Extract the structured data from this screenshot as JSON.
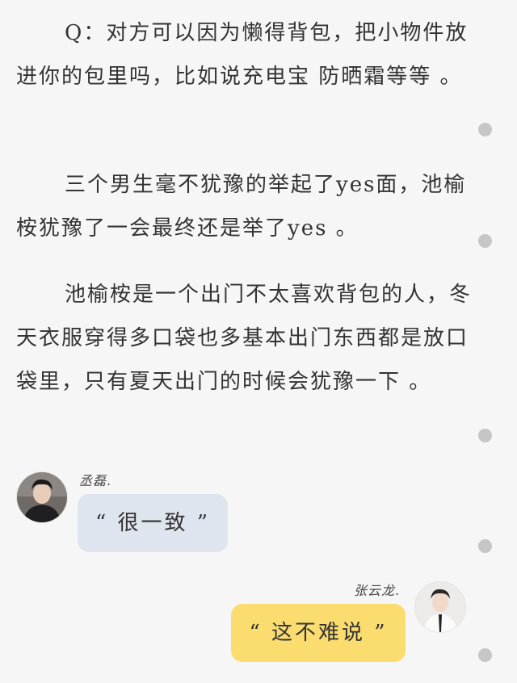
{
  "paragraphs": [
    "Q：对方可以因为懒得背包，把小物件放进你的包里吗，比如说充电宝 防晒霜等等 。",
    "三个男生毫不犹豫的举起了yes面，池榆桉犹豫了一会最终还是举了yes 。",
    "池榆桉是一个出门不太喜欢背包的人，冬天衣服穿得多口袋也多基本出门东西都是放口袋里，只有夏天出门的时候会犹豫一下 。"
  ],
  "chat": {
    "left": {
      "name": "丞磊.",
      "message": "“ 很一致 ”",
      "bubble_color": "#dfe5ee"
    },
    "right": {
      "name": "张云龙.",
      "message": "“ 这不难说 ”",
      "bubble_color": "#fbdc6f"
    }
  },
  "colors": {
    "background": "#f6f6f6",
    "text": "#333333",
    "scroll_dot": "#c6c6c6"
  }
}
